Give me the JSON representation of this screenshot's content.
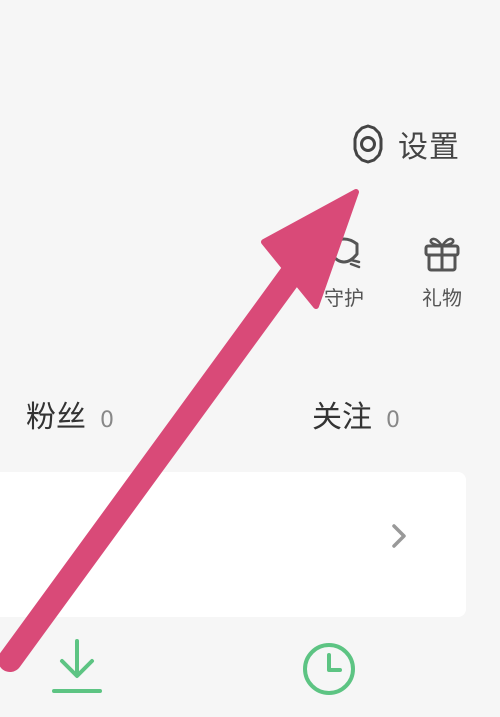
{
  "settings": {
    "label": "设置",
    "icon": "gear-icon"
  },
  "quick_actions": [
    {
      "label": "守护",
      "icon": "guard-icon"
    },
    {
      "label": "礼物",
      "icon": "gift-icon"
    }
  ],
  "stats": [
    {
      "label": "粉丝",
      "count": "0"
    },
    {
      "label": "关注",
      "count": "0"
    }
  ],
  "card": {
    "icon": "chevron-right-icon"
  },
  "bottom_icons": [
    {
      "icon": "download-icon"
    },
    {
      "icon": "clock-icon"
    }
  ],
  "colors": {
    "background": "#f6f6f6",
    "card": "#ffffff",
    "accent_green": "#5dc483",
    "annotation_arrow": "#d94a78"
  }
}
